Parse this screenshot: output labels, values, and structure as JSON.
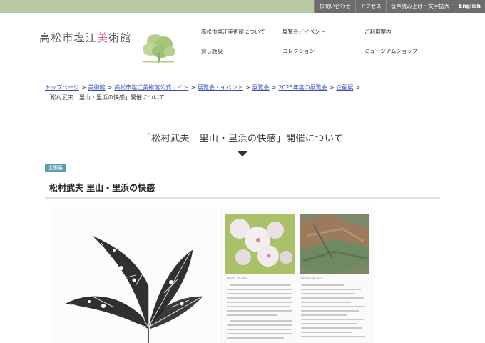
{
  "utility_nav": [
    {
      "label": "お問い合わせ"
    },
    {
      "label": "アクセス"
    },
    {
      "label": "音声読み上げ・文字拡大"
    },
    {
      "label": "English"
    }
  ],
  "logo": {
    "pre": "高松市塩江",
    "accent": "美",
    "post": "術館",
    "accent_color": "#e06a8c"
  },
  "global_nav": [
    {
      "label": "高松市塩江美術館について"
    },
    {
      "label": "展覧会／イベント"
    },
    {
      "label": "ご利用案内"
    },
    {
      "label": "貸し施設"
    },
    {
      "label": "コレクション"
    },
    {
      "label": "ミュージアムショップ"
    }
  ],
  "breadcrumb": [
    {
      "label": "トップページ",
      "link": true
    },
    {
      "label": "美術館",
      "link": true
    },
    {
      "label": "高松市塩江美術館公式サイト",
      "link": true
    },
    {
      "label": "展覧会・イベント",
      "link": true
    },
    {
      "label": "展覧会",
      "link": true
    },
    {
      "label": "2025年度の展覧会",
      "link": true
    },
    {
      "label": "企画展",
      "link": true
    },
    {
      "label": "「松村武夫　里山・里浜の快感」開催について",
      "link": false
    }
  ],
  "page_title": "「松村武夫　里山・里浜の快感」開催について",
  "category_tag": "企画展",
  "section_heading": "松村武夫 里山・里浜の快感",
  "leaflet": {
    "caption1": "《里の花》油彩 2023",
    "caption2": "《岩の肌》油彩 2023"
  },
  "colors": {
    "topbar": "#b9c9a4",
    "utility_button": "#6c6c6c",
    "link": "#3b4fb0",
    "tag": "#5a9ea8"
  }
}
